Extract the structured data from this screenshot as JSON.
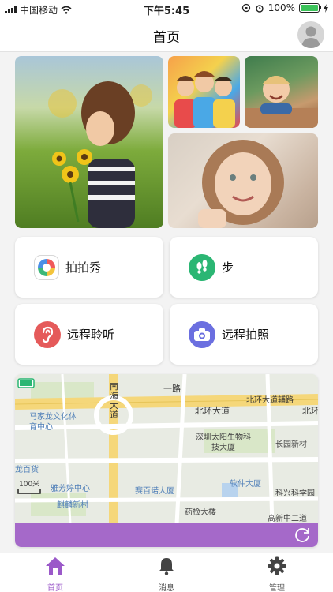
{
  "status_bar": {
    "carrier": "中国移动",
    "time": "下午5:45",
    "battery": "100%"
  },
  "nav": {
    "title": "首页"
  },
  "features": [
    {
      "label": "拍拍秀",
      "icon": "camera-shutter-icon"
    },
    {
      "label": "步",
      "icon": "footprints-icon"
    },
    {
      "label": "远程聆听",
      "icon": "ear-icon"
    },
    {
      "label": "远程拍照",
      "icon": "camera-icon"
    }
  ],
  "map": {
    "labels": [
      "南海大道",
      "一路",
      "北环大道辅路",
      "北环大道",
      "北环",
      "马家龙文化体育中心",
      "深圳太阳生物科技大厦",
      "长园新材",
      "龙百货",
      "雅芳婷中心",
      "麒麟新村",
      "赛百诺大厦",
      "软件大厦",
      "科兴科学园",
      "药检大楼",
      "高新中二道",
      "100米"
    ]
  },
  "colors": {
    "accent": "#a569c9",
    "ear": "#e55a5a",
    "steps": "#2bb673",
    "camera": "#6b6fe0"
  },
  "tabs": [
    {
      "label": "首页",
      "icon": "home-icon",
      "active": true
    },
    {
      "label": "消息",
      "icon": "bell-icon",
      "active": false
    },
    {
      "label": "管理",
      "icon": "gear-icon",
      "active": false
    }
  ]
}
